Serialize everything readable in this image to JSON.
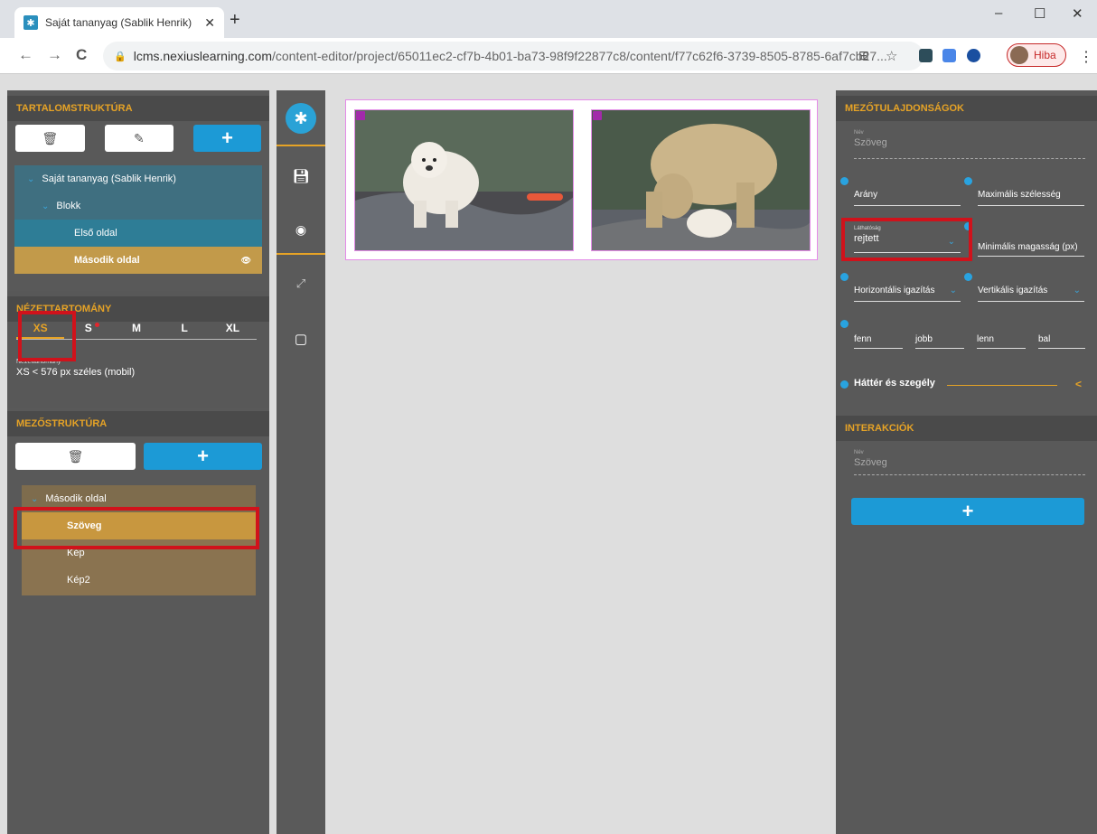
{
  "browser": {
    "tab_title": "Saját tananyag (Sablik Henrik)",
    "close_glyph": "✕",
    "new_tab_glyph": "+",
    "url_host": "lcms.nexiuslearning.com",
    "url_path": "/content-editor/project/65011ec2-cf7b-4b01-ba73-98f9f22877c8/content/f77c62f6-3739-8505-8785-6af7cb27...",
    "profile_label": "Hiba",
    "win_min": "–",
    "win_max": "☐",
    "win_close": "✕",
    "back": "←",
    "forward": "→",
    "reload": "C",
    "star": "☆",
    "menu": "⋮",
    "lock": "🔒"
  },
  "left": {
    "tartalom_title": "TARTALOMSTRUKTÚRA",
    "delete_glyph": "🗑",
    "edit_glyph": "✎",
    "add_glyph": "+",
    "tree": [
      {
        "label": "Saját tananyag (Sablik Henrik)"
      },
      {
        "label": "Blokk"
      },
      {
        "label": "Első oldal"
      },
      {
        "label": "Második oldal"
      }
    ],
    "eye_glyph": "👁",
    "nezet_title": "NÉZETTARTOMÁNY",
    "breakpoints": [
      "XS",
      "S",
      "M",
      "L",
      "XL"
    ],
    "nezet_caption": "Nézettartomány",
    "nezet_value": "XS < 576 px széles (mobil)",
    "mezo_title": "MEZŐSTRUKTÚRA",
    "mezo_tree": [
      {
        "label": "Második oldal"
      },
      {
        "label": "Szöveg"
      },
      {
        "label": "Kép"
      },
      {
        "label": "Kép2"
      }
    ]
  },
  "right": {
    "props_title": "MEZŐTULAJDONSÁGOK",
    "name_caption": "Név",
    "name_value": "Szöveg",
    "arany": "Arány",
    "max_width": "Maximális szélesség",
    "visibility_caption": "Láthatóság",
    "visibility_value": "rejtett",
    "min_height": "Minimális magasság (px)",
    "h_align": "Horizontális igazítás",
    "v_align": "Vertikális igazítás",
    "margins": [
      "fenn",
      "jobb",
      "lenn",
      "bal"
    ],
    "bg_border": "Háttér és szegély",
    "collapse_glyph": "<",
    "interactions_title": "INTERAKCIÓK",
    "int_name_caption": "Név",
    "int_name_value": "Szöveg",
    "int_add_glyph": "+"
  },
  "colors": {
    "accent": "#e6a326",
    "blue": "#1c9ad6",
    "panel": "#595959",
    "highlight": "#d0121b"
  }
}
